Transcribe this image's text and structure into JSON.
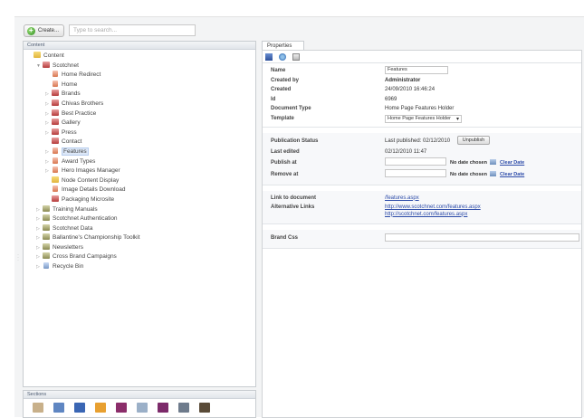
{
  "toolbar": {
    "create_label": "Create...",
    "search_placeholder": "Type to search..."
  },
  "content_panel": {
    "title": "Content",
    "tree": [
      {
        "label": "Content",
        "icon": "folder-icon",
        "level": 0,
        "arrow": ""
      },
      {
        "label": "Scotchnet",
        "icon": "site-gift-icon",
        "level": 1,
        "arrow": "▼"
      },
      {
        "label": "Home Redirect",
        "icon": "document-icon",
        "level": 2,
        "arrow": ""
      },
      {
        "label": "Home",
        "icon": "document-icon",
        "level": 2,
        "arrow": ""
      },
      {
        "label": "Brands",
        "icon": "gift-icon",
        "level": 2,
        "arrow": "▷"
      },
      {
        "label": "Chivas Brothers",
        "icon": "gift-icon",
        "level": 2,
        "arrow": "▷"
      },
      {
        "label": "Best Practice",
        "icon": "gift-icon",
        "level": 2,
        "arrow": "▷"
      },
      {
        "label": "Gallery",
        "icon": "gift-icon",
        "level": 2,
        "arrow": "▷"
      },
      {
        "label": "Press",
        "icon": "gift-icon",
        "level": 2,
        "arrow": "▷"
      },
      {
        "label": "Contact",
        "icon": "gift-icon",
        "level": 2,
        "arrow": ""
      },
      {
        "label": "Features",
        "icon": "document-icon",
        "level": 2,
        "arrow": "▷",
        "selected": true
      },
      {
        "label": "Award Types",
        "icon": "document-icon",
        "level": 2,
        "arrow": "▷"
      },
      {
        "label": "Hero Images Manager",
        "icon": "document-icon",
        "level": 2,
        "arrow": "▷"
      },
      {
        "label": "Node Content Display",
        "icon": "folder-icon",
        "level": 2,
        "arrow": ""
      },
      {
        "label": "Image Details Download",
        "icon": "document-icon",
        "level": 2,
        "arrow": ""
      },
      {
        "label": "Packaging Microsite",
        "icon": "gift-icon",
        "level": 2,
        "arrow": ""
      },
      {
        "label": "Training Manuals",
        "icon": "site-icon",
        "level": 1,
        "arrow": "▷"
      },
      {
        "label": "Scotchnet Authentication",
        "icon": "site-icon",
        "level": 1,
        "arrow": "▷"
      },
      {
        "label": "Scotchnet Data",
        "icon": "site-icon",
        "level": 1,
        "arrow": "▷"
      },
      {
        "label": "Ballantine's Championship Toolkit",
        "icon": "site-icon",
        "level": 1,
        "arrow": "▷"
      },
      {
        "label": "Newsletters",
        "icon": "site-icon",
        "level": 1,
        "arrow": "▷"
      },
      {
        "label": "Cross Brand Campaigns",
        "icon": "site-icon",
        "level": 1,
        "arrow": "▷"
      },
      {
        "label": "Recycle Bin",
        "icon": "recycle-bin-icon",
        "level": 1,
        "arrow": "▷"
      }
    ]
  },
  "sections_panel": {
    "title": "Sections",
    "icons": [
      {
        "name": "content-section-icon",
        "color": "#c8b08a"
      },
      {
        "name": "media-section-icon",
        "color": "#5f86c2"
      },
      {
        "name": "users-section-icon",
        "color": "#3a66b4"
      },
      {
        "name": "settings-section-icon",
        "color": "#e8a030"
      },
      {
        "name": "developer-section-icon",
        "color": "#8b2d6a"
      },
      {
        "name": "members-section-icon",
        "color": "#9bb0c8"
      },
      {
        "name": "translation-section-icon",
        "color": "#7c2a6a"
      },
      {
        "name": "newsletter-section-icon",
        "color": "#6e7b8c"
      },
      {
        "name": "film-section-icon",
        "color": "#5a4b38"
      }
    ]
  },
  "properties": {
    "tab_label": "Properties",
    "toolbar_icons": [
      "save-icon",
      "save-publish-icon",
      "preview-icon"
    ],
    "general": {
      "name_label": "Name",
      "name_value": "Features",
      "created_by_label": "Created by",
      "created_by_value": "Administrator",
      "created_label": "Created",
      "created_value": "24/09/2010 16:46:24",
      "id_label": "Id",
      "id_value": "6969",
      "doctype_label": "Document Type",
      "doctype_value": "Home Page Features Holder",
      "template_label": "Template",
      "template_value": "Home Page Features Holder"
    },
    "publication": {
      "status_label": "Publication Status",
      "status_value": "Last published: 02/12/2010",
      "unpublish_label": "Unpublish",
      "last_edited_label": "Last edited",
      "last_edited_value": "02/12/2010 11:47",
      "publish_at_label": "Publish at",
      "remove_at_label": "Remove at",
      "no_date": "No date chosen",
      "clear_date": "Clear Date"
    },
    "links": {
      "link_label": "Link to document",
      "link_value": "/features.aspx",
      "alt_label": "Alternative Links",
      "alt_1": "http://www.scotchnet.com/features.aspx",
      "alt_2": "http://scotchnet.com/features.aspx"
    },
    "css": {
      "brand_css_label": "Brand Css",
      "brand_css_value": ""
    }
  }
}
